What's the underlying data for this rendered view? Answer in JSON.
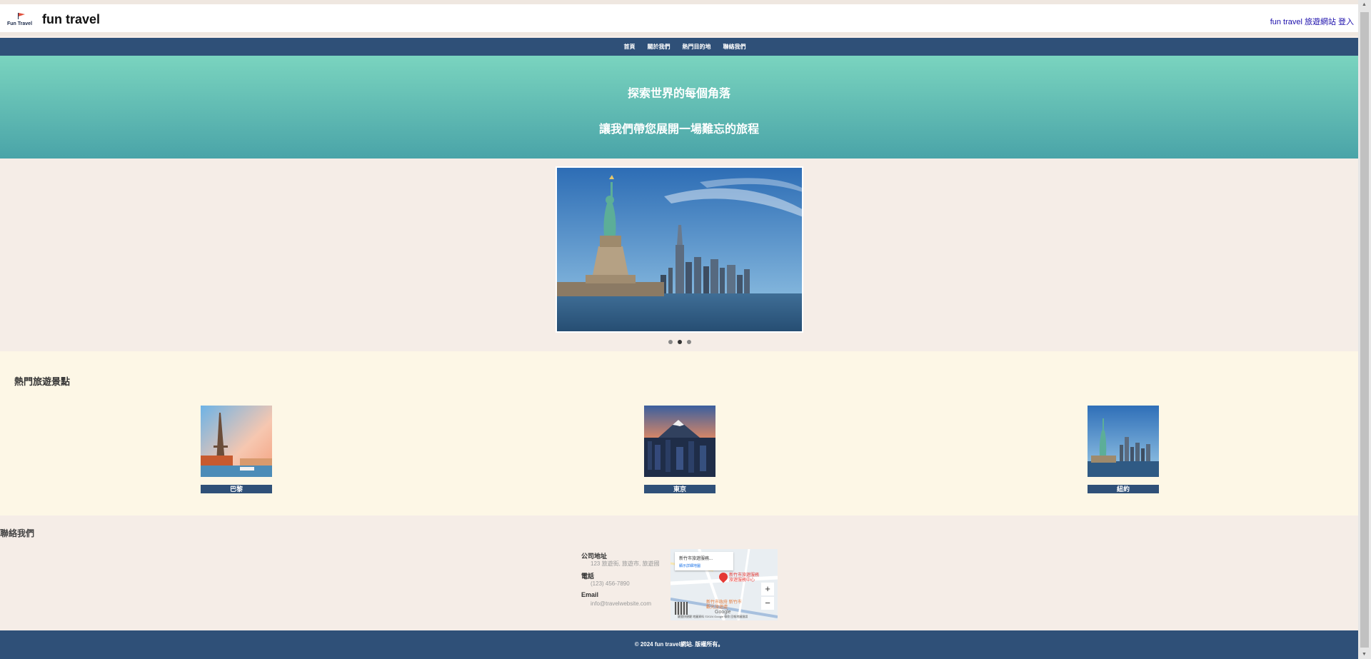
{
  "header": {
    "logo_text": "Fun Travel",
    "site_name": "fun travel",
    "top_link_1": "fun travel 旅遊網站",
    "top_link_2": "登入"
  },
  "nav": {
    "items": [
      {
        "label": "首頁"
      },
      {
        "label": "關於我們"
      },
      {
        "label": "熱門目的地"
      },
      {
        "label": "聯絡我們"
      }
    ]
  },
  "hero": {
    "line1": "探索世界的每個角落",
    "line2": "讓我們帶您展開一場難忘的旅程"
  },
  "carousel": {
    "slide_count": 3,
    "active_index": 1
  },
  "popular": {
    "title": "熱門旅遊景點",
    "destinations": [
      {
        "name": "巴黎"
      },
      {
        "name": "東京"
      },
      {
        "name": "紐約"
      }
    ]
  },
  "contact": {
    "title": "聯絡我們",
    "address_label": "公司地址",
    "address_value": "123 旅遊街, 旅遊市, 旅遊國",
    "phone_label": "電話",
    "phone_value": "(123) 456-7890",
    "email_label": "Email",
    "email_value": "info@travelwebsite.com",
    "map": {
      "card_title": "新竹市旅遊服務...",
      "card_link": "顯示詳細地圖",
      "place_label": "新竹市旅遊服務 旅遊服務中心",
      "place2_label": "新竹市政府 新竹市觀光旅遊處",
      "zoom_in": "+",
      "zoom_out": "−",
      "brand": "Google",
      "footer_text": "鍵盤快捷鍵 地圖資料 ©2024 Google 條款 回報地圖錯誤"
    }
  },
  "footer": {
    "text": "© 2024 fun travel網站. 版權所有。"
  },
  "colors": {
    "nav_bg": "#2f5078",
    "hero_top": "#7ad4bf",
    "hero_bottom": "#4aa4a8",
    "popular_bg": "#fdf7e6",
    "page_bg": "#f5ede7"
  }
}
